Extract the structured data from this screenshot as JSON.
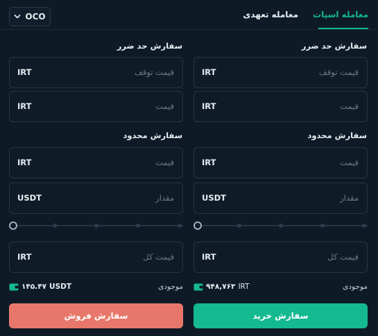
{
  "header": {
    "oco_label": "OCO",
    "tabs": [
      {
        "label": "معامله اسپات",
        "active": true
      },
      {
        "label": "معامله تعهدی",
        "active": false
      }
    ]
  },
  "buy": {
    "stop_section": "سفارش حد ضرر",
    "stop_price": {
      "unit": "IRT",
      "placeholder": "قیمت توقف"
    },
    "stop_limit_price": {
      "unit": "IRT",
      "placeholder": "قیمت"
    },
    "limit_section": "سفارش محدود",
    "limit_price": {
      "unit": "IRT",
      "placeholder": "قیمت"
    },
    "amount": {
      "unit": "USDT",
      "placeholder": "مقدار"
    },
    "slider_percent": 0,
    "total": {
      "unit": "IRT",
      "placeholder": "قیمت کل"
    },
    "balance_label": "موجودی",
    "balance_value": "۹۴۸,۷۶۳",
    "balance_unit": "IRT",
    "submit_label": "سفارش خرید"
  },
  "sell": {
    "stop_section": "سفارش حد ضرر",
    "stop_price": {
      "unit": "IRT",
      "placeholder": "قیمت توقف"
    },
    "stop_limit_price": {
      "unit": "IRT",
      "placeholder": "قیمت"
    },
    "limit_section": "سفارش محدود",
    "limit_price": {
      "unit": "IRT",
      "placeholder": "قیمت"
    },
    "amount": {
      "unit": "USDT",
      "placeholder": "مقدار"
    },
    "slider_percent": 0,
    "total": {
      "unit": "IRT",
      "placeholder": "قیمت کل"
    },
    "balance_label": "موجودی",
    "balance_value": "۱۴۵.۴۷",
    "balance_unit": "USDT",
    "submit_label": "سفارش فروش"
  },
  "colors": {
    "accent_buy": "#14b990",
    "accent_sell": "#e8776b",
    "background": "#0e1b26"
  },
  "icons": [
    "chevron-down-icon",
    "wallet-icon"
  ]
}
